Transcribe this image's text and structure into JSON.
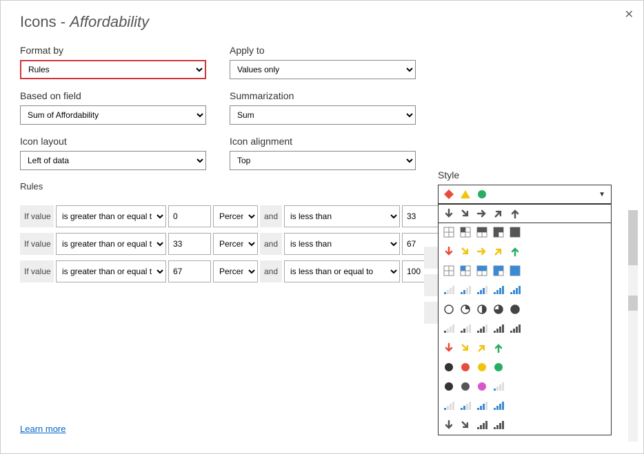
{
  "title_prefix": "Icons - ",
  "title_subject": "Affordability",
  "close_glyph": "✕",
  "format_by": {
    "label": "Format by",
    "value": "Rules"
  },
  "apply_to": {
    "label": "Apply to",
    "value": "Values only"
  },
  "based_on_field": {
    "label": "Based on field",
    "value": "Sum of Affordability"
  },
  "summarization": {
    "label": "Summarization",
    "value": "Sum"
  },
  "icon_layout": {
    "label": "Icon layout",
    "value": "Left of data"
  },
  "icon_alignment": {
    "label": "Icon alignment",
    "value": "Top"
  },
  "style_label": "Style",
  "rules_label": "Rules",
  "if_label": "If value",
  "and_label": "and",
  "learn_more": "Learn more",
  "rules": [
    {
      "op1": "is greater than or equal to",
      "v1": "0",
      "unit": "Percent",
      "op2": "is less than",
      "v2": "33"
    },
    {
      "op1": "is greater than or equal to",
      "v1": "33",
      "unit": "Percent",
      "op2": "is less than",
      "v2": "67"
    },
    {
      "op1": "is greater than or equal to",
      "v1": "67",
      "unit": "Percent",
      "op2": "is less than or equal to",
      "v2": "100"
    }
  ],
  "style_selected": [
    "diamond-red",
    "triangle-yellow",
    "circle-green"
  ],
  "style_options": [
    [
      "arrow-down-gray",
      "arrow-dr-gray",
      "arrow-right-gray",
      "arrow-ur-gray",
      "arrow-up-gray"
    ],
    [
      "quad-empty",
      "quad-1-gray",
      "quad-2-gray",
      "quad-3-gray",
      "quad-full-gray"
    ],
    [
      "arrow-down-red",
      "arrow-dr-yellow",
      "arrow-right-yellow",
      "arrow-ur-yellow",
      "arrow-up-green"
    ],
    [
      "quad-empty",
      "quad-1-blue",
      "quad-2-blue",
      "quad-3-blue",
      "quad-full-blue"
    ],
    [
      "bars-1-blue",
      "bars-2-blue",
      "bars-3-blue",
      "bars-4-blue",
      "bars-5-blue"
    ],
    [
      "pie-empty",
      "pie-q1",
      "pie-half",
      "pie-q3",
      "pie-full"
    ],
    [
      "bars-1-gray",
      "bars-2-gray",
      "bars-3-gray",
      "bars-4-gray",
      "bars-5-gray"
    ],
    [
      "arrow-down-red",
      "arrow-dr-yellow",
      "arrow-ur-yellow",
      "arrow-up-green",
      "blank"
    ],
    [
      "circle-dark",
      "circle-red",
      "circle-yellow",
      "circle-green",
      "blank"
    ],
    [
      "circle-dark",
      "circle-gray",
      "circle-pink",
      "bars-1-blue",
      "blank"
    ],
    [
      "bars-1-blue",
      "bars-2-blue",
      "bars-3-blue",
      "bars-4-blue",
      "blank"
    ],
    [
      "arrow-down-gray",
      "arrow-dr-gray",
      "bars-4-gray",
      "bars-5-gray",
      "blank"
    ]
  ]
}
